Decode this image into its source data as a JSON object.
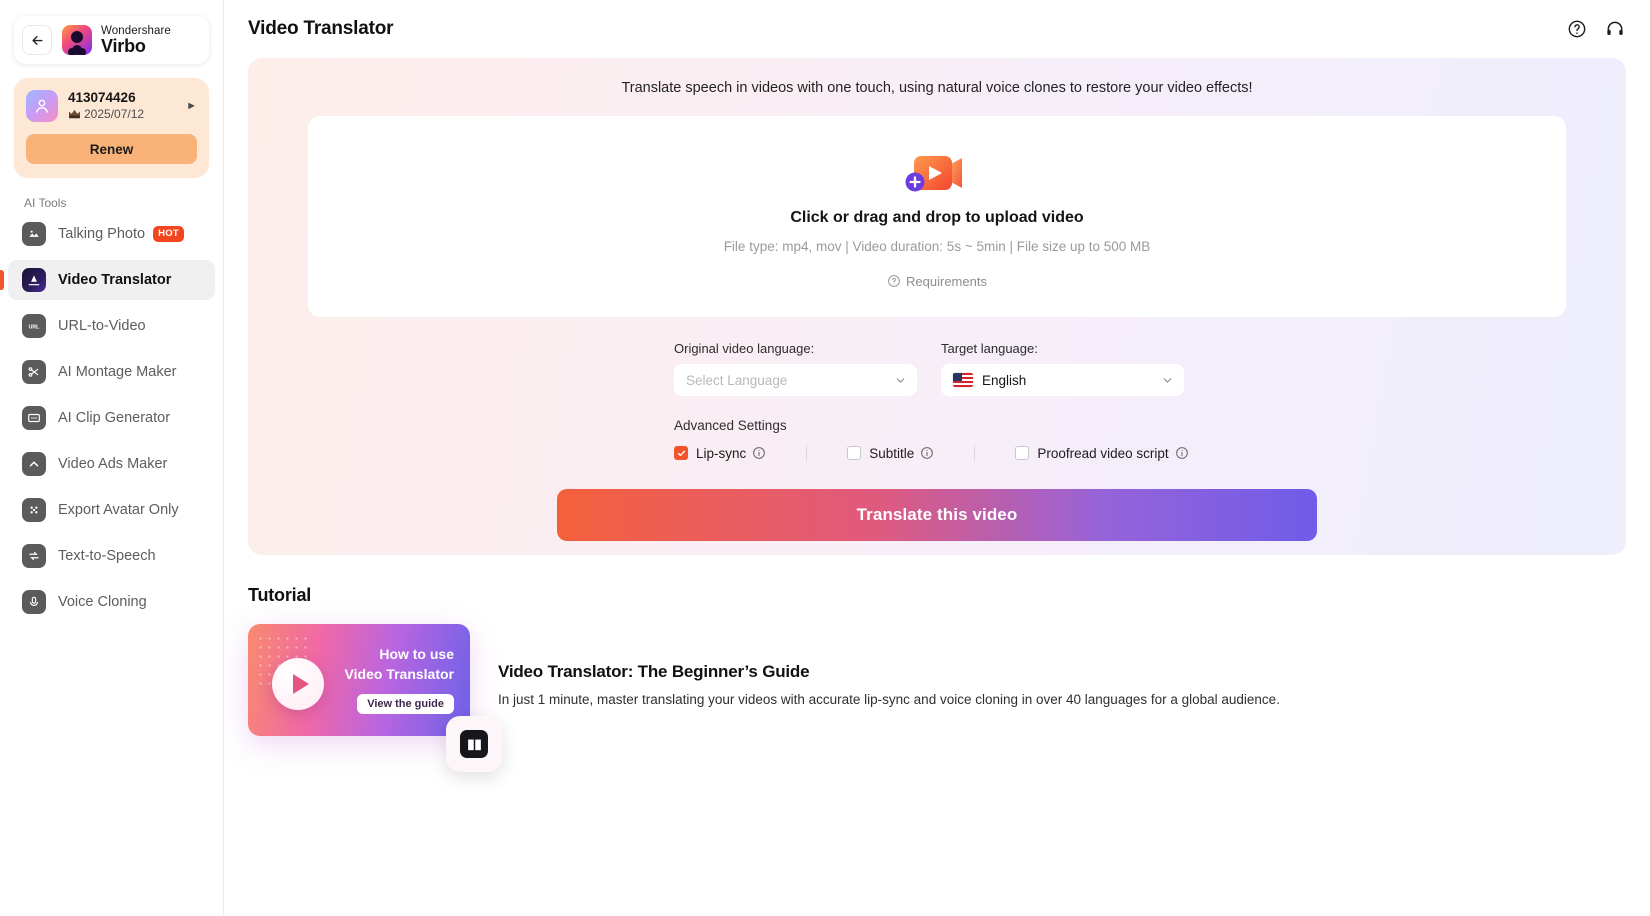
{
  "sidebar": {
    "brand": {
      "top": "Wondershare",
      "bottom": "Virbo",
      "back_icon": "arrow-left-icon"
    },
    "account": {
      "id": "413074426",
      "expiry": "2025/07/12",
      "renew_label": "Renew"
    },
    "section_label": "AI Tools",
    "items": [
      {
        "label": "Talking Photo",
        "icon": "image-icon",
        "badge": "HOT",
        "active": false
      },
      {
        "label": "Video Translator",
        "icon": "translate-icon",
        "badge": "",
        "active": true
      },
      {
        "label": "URL-to-Video",
        "icon": "url-icon",
        "badge": "",
        "active": false
      },
      {
        "label": "AI Montage Maker",
        "icon": "scissors-icon",
        "badge": "",
        "active": false
      },
      {
        "label": "AI Clip Generator",
        "icon": "clip-icon",
        "badge": "",
        "active": false
      },
      {
        "label": "Video Ads Maker",
        "icon": "chevron-up-icon",
        "badge": "",
        "active": false
      },
      {
        "label": "Export Avatar Only",
        "icon": "grid-dots-icon",
        "badge": "",
        "active": false
      },
      {
        "label": "Text-to-Speech",
        "icon": "swap-icon",
        "badge": "",
        "active": false
      },
      {
        "label": "Voice Cloning",
        "icon": "mic-icon",
        "badge": "",
        "active": false
      }
    ]
  },
  "header": {
    "title": "Video Translator",
    "help_icon": "help-circle-icon",
    "support_icon": "headset-icon"
  },
  "panel": {
    "tagline": "Translate speech in videos with one touch, using natural voice clones to restore your video effects!",
    "dropzone": {
      "icon": "video-upload-icon",
      "title": "Click or drag and drop to upload video",
      "subtitle": "File type: mp4, mov  |  Video duration: 5s ~ 5min  |  File size up to 500 MB",
      "requirements_label": "Requirements",
      "requirements_icon": "help-circle-icon"
    },
    "original_language": {
      "label": "Original video language:",
      "value": "",
      "placeholder": "Select Language",
      "chevron_icon": "chevron-down-icon"
    },
    "target_language": {
      "label": "Target language:",
      "value": "English",
      "flag": "us-flag-icon",
      "chevron_icon": "chevron-down-icon"
    },
    "advanced_settings_label": "Advanced Settings",
    "options": [
      {
        "label": "Lip-sync",
        "checked": true,
        "info_icon": "info-icon"
      },
      {
        "label": "Subtitle",
        "checked": false,
        "info_icon": "info-icon"
      },
      {
        "label": "Proofread video script",
        "checked": false,
        "info_icon": "info-icon"
      }
    ],
    "submit_label": "Translate this video",
    "submit_gradient_from": "#f4603b",
    "submit_gradient_to": "#6f5ce8"
  },
  "tutorial": {
    "section_title": "Tutorial",
    "thumb_line1": "How to use",
    "thumb_line2": "Video Translator",
    "thumb_button": "View the guide",
    "badge_icon": "book-icon",
    "heading": "Video Translator: The Beginner’s Guide",
    "description": "In just 1 minute, master translating your videos with accurate lip-sync and voice cloning in over 40 languages for a global audience."
  }
}
